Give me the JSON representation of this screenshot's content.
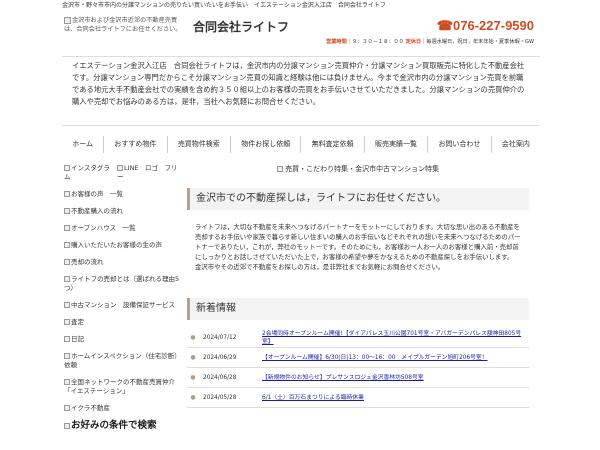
{
  "topline": "金沢市・野々市市内の分譲マンションの売りたい買いたいをお手伝い　イエステーション金沢入江店　合同会社ライトフ",
  "header": {
    "logo_alt": "金沢市および金沢市近郊の不動産売買は、合同会社ライトフにお任せください。",
    "company": "合同会社ライトフ",
    "phone": "☎076-227-9590",
    "hours_label": "営業時間",
    "hours_value": "｜９：３０－１８：００",
    "holiday_label": "定休日",
    "holiday_value": "｜毎週水曜日，祝日，年末年始・夏季休暇・GW"
  },
  "intro": "イエステーション金沢入江店　合同会社ライトフは，金沢市内の分譲マンション売買仲介・分譲マンション買取販売に特化した不動産会社です。分譲マンション専門だからこそ分譲マンション売買の知識と経験は他には負けません。今まで金沢市内の分譲マンション売買を前職である地元大手不動産会社での実績を含め約３５０組以上のお客様の売買をお手伝いさせていただきました。分譲マンションの売買仲介の購入や売却でお悩みのある方は，是非，当社へお気軽にお問合せください。",
  "nav": [
    "ホーム",
    "おすすめ物件",
    "売買物件検索",
    "物件お探し依頼",
    "無料査定依頼",
    "販売実績一覧",
    "お問い合わせ",
    "会社案内"
  ],
  "sidebar": {
    "row1": [
      "インスタグラム",
      "LINE　ロゴ　フリー"
    ],
    "items": [
      "お客様の声　一覧",
      "不動産購入の流れ",
      "オープンハウス　一覧",
      "購入いただいたお客様の生の声",
      "売却の流れ",
      "ライトフの売却とは（選ばれる理由5つ）",
      "中古マンション　設備保証サービス",
      "査定",
      "日記",
      "ホームインスペクション（住宅診断）依頼",
      "全国ネットワークの不動産売買仲介「イエステーション」",
      "イクラ不動産"
    ],
    "search_heading": "お好みの条件で検索"
  },
  "main": {
    "banner": "売買・こだわり特集・金沢市中古マンション特集",
    "section_title": "金沢市での不動産探しは，ライトフにお任せください。",
    "body": "ライトフは，大切な不動産を未来へつなげるパートナーをモットーにしております。大切な思い出のある不動産を売却するお手伝いや家族で暮らす新しい住まいの購入のお手伝いなどそれぞれの想いを未来へつなげるためのパートナーでありたい，これが，弊社のモットーです。そのためにも，お客様お一人お一人のお客様と購入前・売却前にしっかりとお話しさせていただいた上で，お客様の希望や夢をかなえるための不動産探しをお手伝いします。\n金沢市やその近郊で不動産をお探しの方は，是非弊社までお気軽にお問合せください。",
    "news_title": "新着情報",
    "news": [
      {
        "date": "2024/07/12",
        "title": "2会場同時オープンルーム開催!【ダイアパレス玉川公園701号室・アバガーデンパレス額神田805号室】"
      },
      {
        "date": "2024/06/29",
        "title": "【オープンルーム開催】6/30(日)13：00～16：00　メイプルガーデン旭町206号室！"
      },
      {
        "date": "2024/06/28",
        "title": "【新規物件のお知らせ】プレサンスロジェ金沢香林坊508号室"
      },
      {
        "date": "2024/05/28",
        "title": "6/1（土）百万石まつりによる臨時休業"
      }
    ]
  },
  "colors": {
    "accent": "#d14a1f",
    "link": "#1a1aa6",
    "section_border": "#b3a090"
  }
}
